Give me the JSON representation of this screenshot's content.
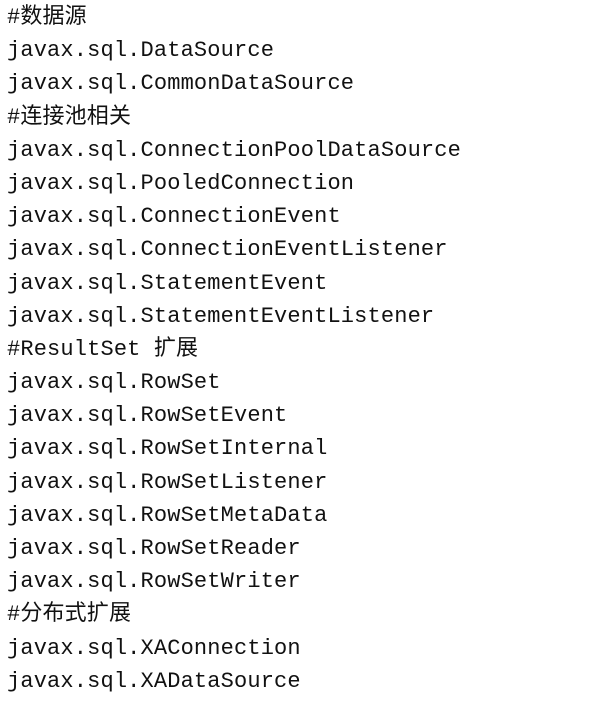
{
  "lines": [
    {
      "text": "#数据源",
      "kind": "comment"
    },
    {
      "text": "javax.sql.DataSource",
      "kind": "code"
    },
    {
      "text": "javax.sql.CommonDataSource",
      "kind": "code"
    },
    {
      "text": "#连接池相关",
      "kind": "comment"
    },
    {
      "text": "javax.sql.ConnectionPoolDataSource",
      "kind": "code"
    },
    {
      "text": "javax.sql.PooledConnection",
      "kind": "code"
    },
    {
      "text": "javax.sql.ConnectionEvent",
      "kind": "code"
    },
    {
      "text": "javax.sql.ConnectionEventListener",
      "kind": "code"
    },
    {
      "text": "javax.sql.StatementEvent",
      "kind": "code"
    },
    {
      "text": "javax.sql.StatementEventListener",
      "kind": "code"
    },
    {
      "text": "#ResultSet 扩展",
      "kind": "comment"
    },
    {
      "text": "javax.sql.RowSet",
      "kind": "code"
    },
    {
      "text": "javax.sql.RowSetEvent",
      "kind": "code"
    },
    {
      "text": "javax.sql.RowSetInternal",
      "kind": "code"
    },
    {
      "text": "javax.sql.RowSetListener",
      "kind": "code"
    },
    {
      "text": "javax.sql.RowSetMetaData",
      "kind": "code"
    },
    {
      "text": "javax.sql.RowSetReader",
      "kind": "code"
    },
    {
      "text": "javax.sql.RowSetWriter",
      "kind": "code"
    },
    {
      "text": "#分布式扩展",
      "kind": "comment"
    },
    {
      "text": "javax.sql.XAConnection",
      "kind": "code"
    },
    {
      "text": "javax.sql.XADataSource",
      "kind": "code"
    }
  ]
}
